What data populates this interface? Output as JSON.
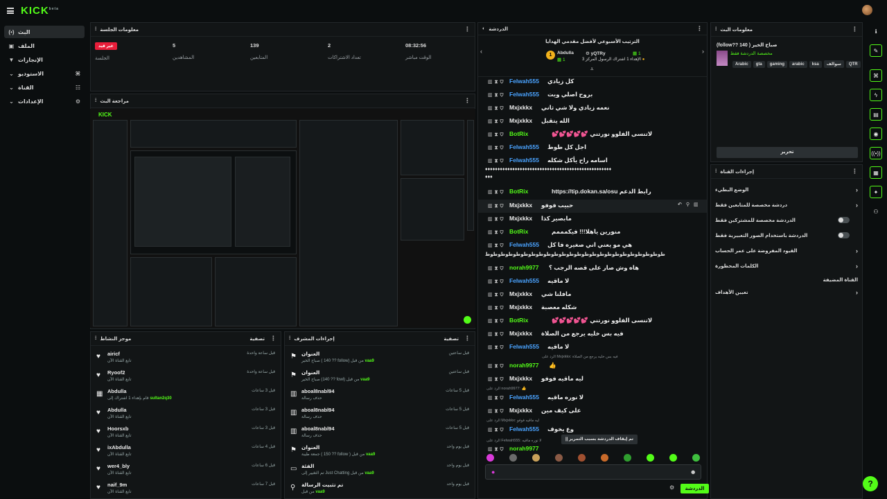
{
  "topbar": {
    "logo": "KICK",
    "logo_sup": "beta"
  },
  "nav": {
    "items": [
      {
        "label": "البث",
        "icon": "(•)"
      },
      {
        "label": "الملف",
        "icon": "▣"
      },
      {
        "label": "الإنجازات",
        "icon": "🏆"
      },
      {
        "label": "الاستوديو",
        "icon": "⌄"
      },
      {
        "label": "القناة",
        "icon": "⌄"
      },
      {
        "label": "الإعدادات",
        "icon": "⌄"
      }
    ]
  },
  "session": {
    "title": "معلومات الجلسة",
    "live_badge": "غير قيد",
    "session_label": "الجلسة",
    "stats": [
      {
        "value": "5",
        "label": "المشاهدين"
      },
      {
        "value": "139",
        "label": "المتابعين"
      },
      {
        "value": "2",
        "label": "تعداد الاشتراكات"
      },
      {
        "value": "08:32:56",
        "label": "الوقت مباشر"
      }
    ]
  },
  "preview": {
    "title": "مراجعة البث",
    "mini_logo": "KICK"
  },
  "activity": {
    "title": "موجز النشاط",
    "filter": "تصفية",
    "rows": [
      {
        "name": "airicf",
        "sub": "تابع القناة الآن",
        "time": "قبل ساعة واحدة",
        "icon": "♥"
      },
      {
        "name": "Ryoof2",
        "sub": "تابع القناة الآن",
        "time": "قبل ساعة واحدة",
        "icon": "♥"
      },
      {
        "name": "Abdulla",
        "sub": "قام بإهداء 1 اشتراك إلى",
        "extra": "sultan2q30",
        "time": "قبل 3 ساعات",
        "icon": "▦"
      },
      {
        "name": "Abdulla",
        "sub": "تابع القناة الآن",
        "time": "قبل 3 ساعات",
        "icon": "♥"
      },
      {
        "name": "Hoorsxb",
        "sub": "تابع القناة الآن",
        "time": "قبل 3 ساعات",
        "icon": "♥"
      },
      {
        "name": "ixAbdulla",
        "sub": "تابع القناة الآن",
        "time": "قبل 4 ساعات",
        "icon": "♥"
      },
      {
        "name": "wer4_bly",
        "sub": "تابع القناة الآن",
        "time": "قبل 6 ساعات",
        "icon": "♥"
      },
      {
        "name": "naif_9m",
        "sub": "تابع القناة الآن",
        "time": "قبل 7 ساعات",
        "icon": "♥"
      }
    ]
  },
  "modactions": {
    "title": "إجراءات المشرف",
    "filter": "تصفية",
    "rows": [
      {
        "name": "العنوان",
        "sub": "صباح الخير ( 140 ?? follow) من قبل",
        "by": "vaa9",
        "time": "قبل ساعتين",
        "icon": "⚑"
      },
      {
        "name": "العنوان",
        "sub": "صباح الخير (140 ?? fowl) من قبل",
        "by": "vaa9",
        "time": "قبل ساعتين",
        "icon": "⚑"
      },
      {
        "name": "aboal8nabl94",
        "sub": "حذف رسالة",
        "time": "قبل 5 ساعات",
        "icon": "🗑"
      },
      {
        "name": "aboal8nabl94",
        "sub": "حذف رسالة",
        "time": "قبل 5 ساعات",
        "icon": "🗑"
      },
      {
        "name": "aboal8nabl94",
        "sub": "حذف رسالة",
        "time": "قبل 5 ساعات",
        "icon": "🗑"
      },
      {
        "name": "العنوان",
        "sub": "جمعة طيبة ( 150 ?? follow ) من قبل",
        "by": "vaa9",
        "time": "قبل يوم واحد",
        "icon": "⚑"
      },
      {
        "name": "الفئة",
        "sub": "تم التغيير إلى Just Chatting من قبل",
        "by": "vaa9",
        "time": "قبل يوم واحد",
        "icon": "▭"
      },
      {
        "name": "تم تثبيت الرسالة",
        "sub": "من قبل",
        "by": "vaa9",
        "time": "قبل يوم واحد",
        "icon": "⚲"
      }
    ]
  },
  "chat": {
    "title": "الدردشة",
    "leaderboard_title": "الترتيب الأسبوعي لأفضل مقدمي الهدايا",
    "leader1": {
      "name": "Abdulla",
      "count": "1",
      "rank": "1"
    },
    "leader2": {
      "name": "yQTRy",
      "count": "1"
    },
    "leader3_text": "الإهداء 1 اشتراك الرسول المركز 3",
    "messages": [
      {
        "user": "Felwah555",
        "text": "كل زيادي",
        "color": "#4aa3ff"
      },
      {
        "user": "Felwah555",
        "text": "بروح اصلي ويت",
        "color": "#4aa3ff"
      },
      {
        "user": "Mxjxkkx",
        "text": "نعمه زيادي ولا شي ثاني",
        "color": "#e6e6e6"
      },
      {
        "user": "Mxjxkkx",
        "text": "الله يتقبل",
        "color": "#e6e6e6"
      },
      {
        "user": "BotRix",
        "text": "لاتنسى الفلوو نورتني 💕💕💕💕💕",
        "color": "#53fc18",
        "bot": true
      },
      {
        "user": "Felwah555",
        "text": "اجل كل طوط",
        "color": "#4aa3ff"
      },
      {
        "user": "Felwah555",
        "text": "اسامه راح يأكل شكله",
        "color": "#4aa3ff"
      }
    ],
    "spam_line": "♦♦♦♦♦♦♦♦♦♦♦♦♦♦♦♦♦♦♦♦♦♦♦♦♦♦♦♦♦♦♦♦♦♦♦♦♦♦♦♦♦♦♦♦♦♦♦♦♦♦♦",
    "spam_line2": "♦♦♦",
    "messages2": [
      {
        "user": "BotRix",
        "text": "رابط الدعم https://tip.dokan.sa/osu",
        "color": "#53fc18",
        "bot": true
      },
      {
        "user": "Mxjxkkx",
        "text": "حبيب فوفو",
        "color": "#e6e6e6"
      },
      {
        "user": "Mxjxkkx",
        "text": "مابصير كذا",
        "color": "#e6e6e6"
      },
      {
        "user": "BotRix",
        "text": "منورين ياهلا!!! فيكمممم",
        "color": "#53fc18",
        "bot": true
      },
      {
        "user": "Felwah555",
        "text": "هي مو يعني اني صغيره فا كل",
        "color": "#4aa3ff"
      }
    ],
    "wrap_line": "طوطوطوطوطوطوطوطوطوطوطوطوطوطوطوطوطوطوطوطوطوطوطوط",
    "messages3": [
      {
        "user": "norah9977",
        "text": "هاه وش صار على قصه الرجب ؟",
        "color": "#53fc18"
      },
      {
        "user": "Felwah555",
        "text": "لا ماقيه",
        "color": "#4aa3ff"
      },
      {
        "user": "Mxjxkkx",
        "text": "مافلنا شي",
        "color": "#e6e6e6"
      },
      {
        "user": "Mxjxkkx",
        "text": "شكله معصبة",
        "color": "#e6e6e6"
      },
      {
        "user": "BotRix",
        "text": "لاتنسى الفلوو نورتني 💕💕💕💕💕",
        "color": "#53fc18",
        "bot": true
      },
      {
        "user": "Mxjxkkx",
        "text": "فيه بس خليه يرجع من الصلاة",
        "color": "#e6e6e6"
      },
      {
        "user": "Felwah555",
        "text": "لا ماقيه",
        "color": "#4aa3ff"
      }
    ],
    "reply1": "الرد على Mxjxkkx: فيه بس خليه يرجع من الصلاة",
    "msg_r1": {
      "user": "norah9977",
      "text": "👍",
      "color": "#53fc18"
    },
    "msg_r2": {
      "user": "Mxjxkkx",
      "text": "ليه ماقيه فوفو",
      "color": "#e6e6e6"
    },
    "reply2": "الرد على norah9977: 👍",
    "msg_r3": {
      "user": "Felwah555",
      "text": "لا نوره ماقيه",
      "color": "#4aa3ff"
    },
    "msg_r4": {
      "user": "Mxjxkkx",
      "text": "على كيف مين",
      "color": "#e6e6e6"
    },
    "reply3": "الرد على Mxjxkkx: ليه ماقيه فوفو",
    "msg_r5": {
      "user": "Felwah555",
      "text": "وع يخوف",
      "color": "#4aa3ff"
    },
    "paused": "|| تم إيقاف الدردشة بسبب التمرير",
    "reply4": "الرد على Felwah555: لا نوره ماقيه",
    "msg_r6": {
      "user": "norah9977",
      "text": "",
      "color": "#53fc18"
    },
    "send_label": "الدردشة",
    "input_placeholder": ""
  },
  "streaminfo": {
    "title": "معلومات البث",
    "stream_title": "صباح الخير ( 140 ??follow)",
    "category": "مخصصة الدردشة فقط",
    "tags": [
      "QTR",
      "سوالف",
      "ksa",
      "arabic",
      "gaming",
      "gta",
      "Arabic"
    ],
    "edit_label": "تحرير"
  },
  "channelactions": {
    "title": "إجراءات القناة",
    "items": [
      {
        "label": "الوضع البطيء",
        "type": "chev"
      },
      {
        "label": "دردشة مخصصة للمتابعين فقط",
        "type": "chev"
      },
      {
        "label": "الدردشة مخصصة للمشتركين فقط",
        "type": "toggle"
      },
      {
        "label": "الدردشة باستخدام الصور التعبيرية فقط",
        "type": "toggle"
      },
      {
        "label": "القيود المفروضة على عمر الحساب",
        "type": "chev"
      },
      {
        "label": "الكلمات المحظورة",
        "type": "chev"
      },
      {
        "label": "القناة المضيفة",
        "type": "none"
      },
      {
        "label": "تعيين الأهداف",
        "type": "chev"
      }
    ]
  },
  "colors": {
    "accent": "#53fc18",
    "live": "#e91e3a",
    "link": "#4aa3ff"
  }
}
